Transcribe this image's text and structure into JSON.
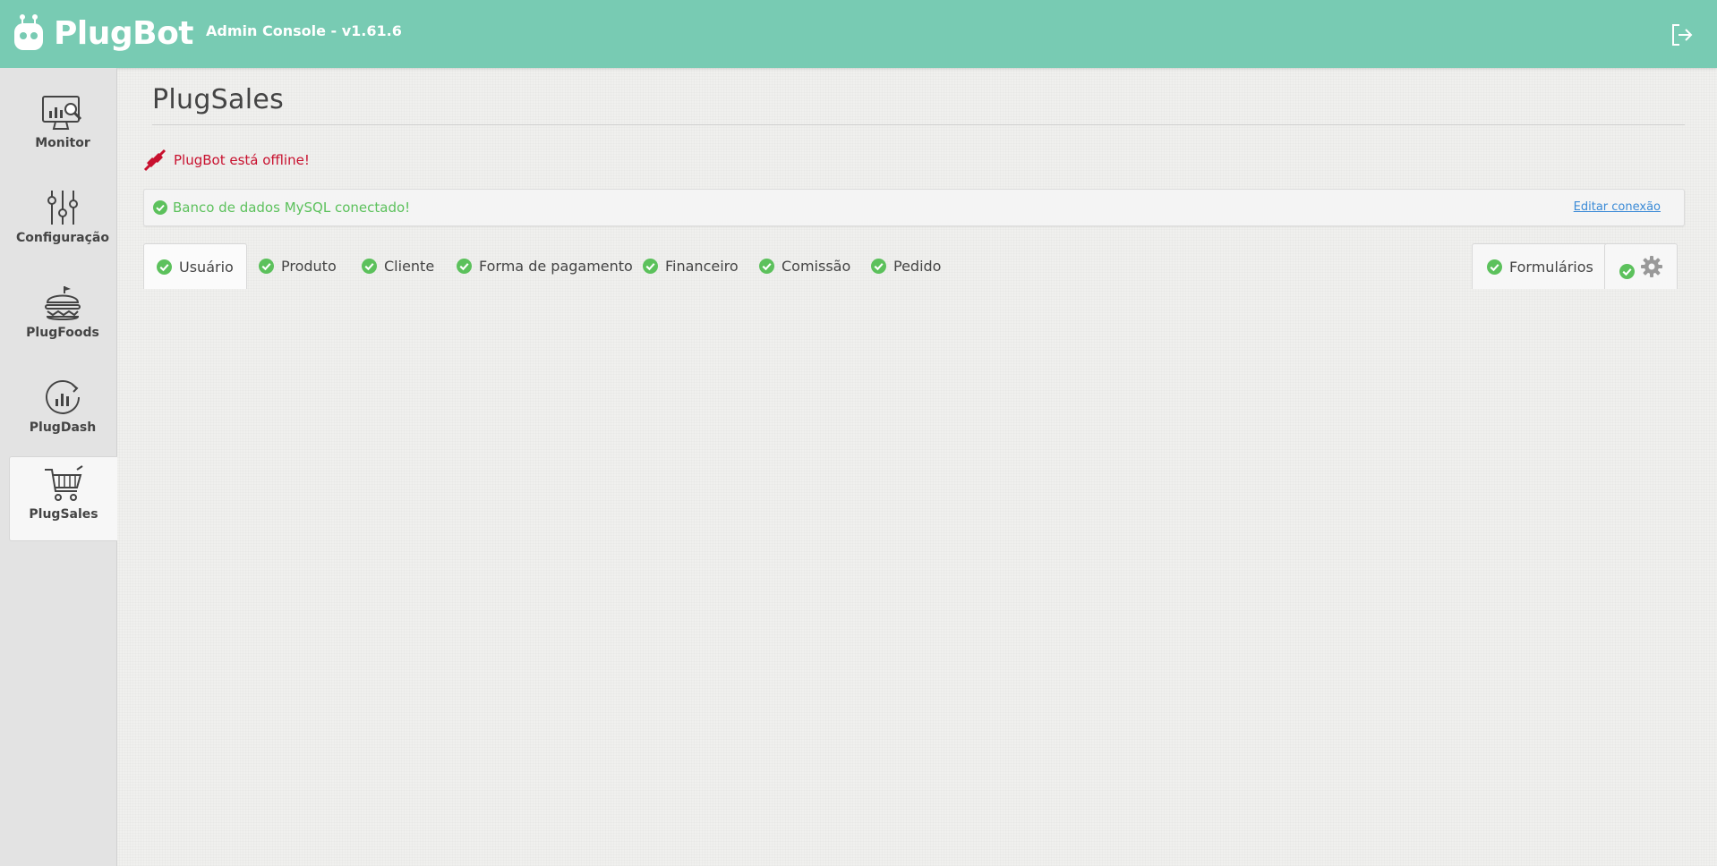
{
  "app": {
    "name": "PlugBot",
    "console_title": "Admin Console - v1.61.6"
  },
  "sidebar": {
    "items": [
      {
        "label": "Monitor",
        "icon": "monitor-icon"
      },
      {
        "label": "Configuração",
        "icon": "sliders-icon"
      },
      {
        "label": "PlugFoods",
        "icon": "burger-icon"
      },
      {
        "label": "PlugDash",
        "icon": "dashboard-icon"
      },
      {
        "label": "PlugSales",
        "icon": "cart-icon",
        "active": true
      }
    ]
  },
  "page": {
    "title": "PlugSales",
    "offline_message": "PlugBot está offline!",
    "db_status": "Banco de dados MySQL conectado!",
    "edit_connection": "Editar conexão"
  },
  "tabs": [
    {
      "label": "Usuário",
      "active": true
    },
    {
      "label": "Produto"
    },
    {
      "label": "Cliente"
    },
    {
      "label": "Forma de pagamento"
    },
    {
      "label": "Financeiro"
    },
    {
      "label": "Comissão"
    },
    {
      "label": "Pedido"
    }
  ],
  "right_tabs": {
    "forms_label": "Formulários",
    "settings_icon": "gear-icon"
  },
  "colors": {
    "header": "#78cbb3",
    "success": "#5cc15c",
    "danger": "#c8102e",
    "link": "#3a8ad6"
  }
}
